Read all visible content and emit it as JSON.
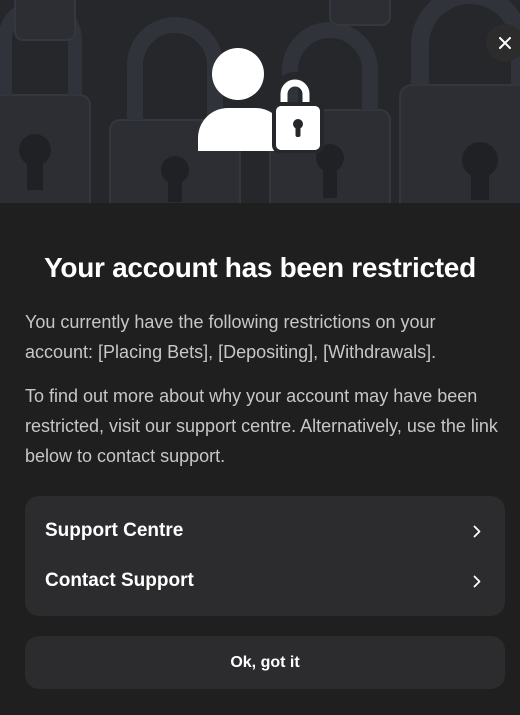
{
  "dialog": {
    "title": "Your account has been restricted",
    "paragraph_1": "You currently have the following restrictions on your account: [Placing Bets], [Depositing], [Withdrawals].",
    "paragraph_2": "To find out more about why your account may have been restricted, visit our support centre. Alternatively, use the link below to contact support.",
    "links": [
      {
        "label": "Support Centre",
        "icon": "chevron-right-icon"
      },
      {
        "label": "Contact Support",
        "icon": "chevron-right-icon"
      }
    ],
    "confirm_label": "Ok, got it",
    "close_icon": "close-icon",
    "hero_icon": "user-locked-icon"
  },
  "colors": {
    "background": "#1f1f1f",
    "hero_background": "#25272b",
    "card_background": "#2c2c2e",
    "text_primary": "#ffffff",
    "text_secondary": "#c7c7c7"
  }
}
